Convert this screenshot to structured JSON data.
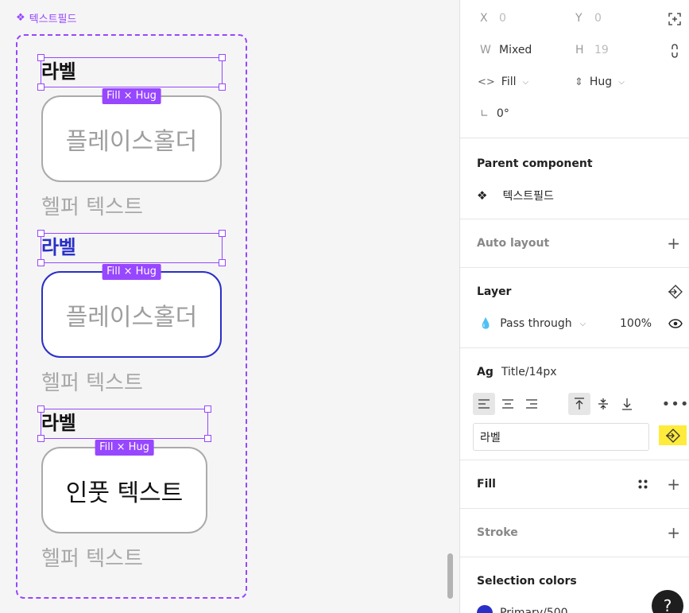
{
  "canvas": {
    "component_title": "텍스트필드",
    "fields": [
      {
        "label": "라벨",
        "badge": "Fill × Hug",
        "input_text": "플레이스홀더",
        "helper": "헬퍼 텍스트",
        "state": "default"
      },
      {
        "label": "라벨",
        "badge": "Fill × Hug",
        "input_text": "플레이스홀더",
        "helper": "헬퍼 텍스트",
        "state": "focused"
      },
      {
        "label": "라벨",
        "badge": "Fill × Hug",
        "input_text": "인풋 텍스트",
        "helper": "헬퍼 텍스트",
        "state": "filled"
      }
    ]
  },
  "panel": {
    "x_label": "X",
    "x_value": "0",
    "y_label": "Y",
    "y_value": "0",
    "w_label": "W",
    "w_value": "Mixed",
    "h_label": "H",
    "h_value": "19",
    "width_sizing": "Fill",
    "height_sizing": "Hug",
    "rotation": "0°",
    "parent_component_title": "Parent component",
    "parent_component_name": "텍스트필드",
    "auto_layout_title": "Auto layout",
    "layer_title": "Layer",
    "blend_mode": "Pass through",
    "opacity": "100%",
    "typography_sample": "Ag",
    "text_style": "Title/14px",
    "text_content": "라벨",
    "fill_title": "Fill",
    "stroke_title": "Stroke",
    "selection_colors_title": "Selection colors",
    "selection_color_name": "Primary/500",
    "help": "?"
  },
  "colors": {
    "component_purple": "#9747ff",
    "primary_blue": "#2a2fc7",
    "variable_highlight": "#ffeb3b"
  }
}
